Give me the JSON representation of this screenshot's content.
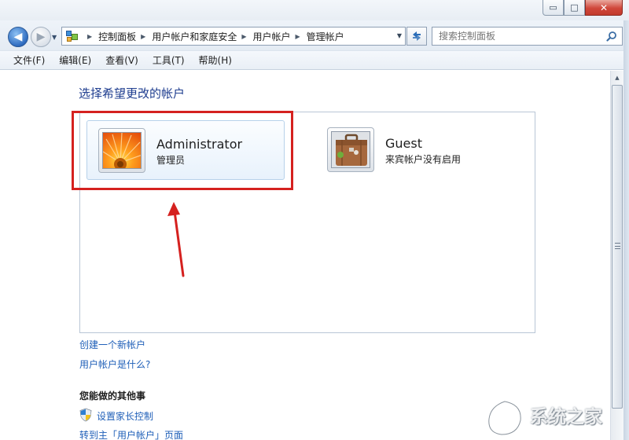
{
  "window": {
    "controls": {
      "minimize": "▭",
      "maximize": "□",
      "close": "✕"
    }
  },
  "navigation": {
    "breadcrumb": [
      "控制面板",
      "用户帐户和家庭安全",
      "用户帐户",
      "管理帐户"
    ],
    "search_placeholder": "搜索控制面板"
  },
  "menu": [
    "文件(F)",
    "编辑(E)",
    "查看(V)",
    "工具(T)",
    "帮助(H)"
  ],
  "main": {
    "section_title": "选择希望更改的帐户",
    "accounts": [
      {
        "name": "Administrator",
        "type": "管理员",
        "icon": "flower-picture-icon",
        "selected": true
      },
      {
        "name": "Guest",
        "type": "来宾帐户没有启用",
        "icon": "suitcase-picture-icon",
        "selected": false
      }
    ],
    "links": [
      "创建一个新帐户",
      "用户帐户是什么?"
    ],
    "other_tasks_title": "您能做的其他事",
    "tasks": [
      "设置家长控制",
      "转到主「用户帐户」页面"
    ]
  },
  "annotation": {
    "color": "#d5211f"
  },
  "watermark": {
    "text": "系统之家"
  }
}
